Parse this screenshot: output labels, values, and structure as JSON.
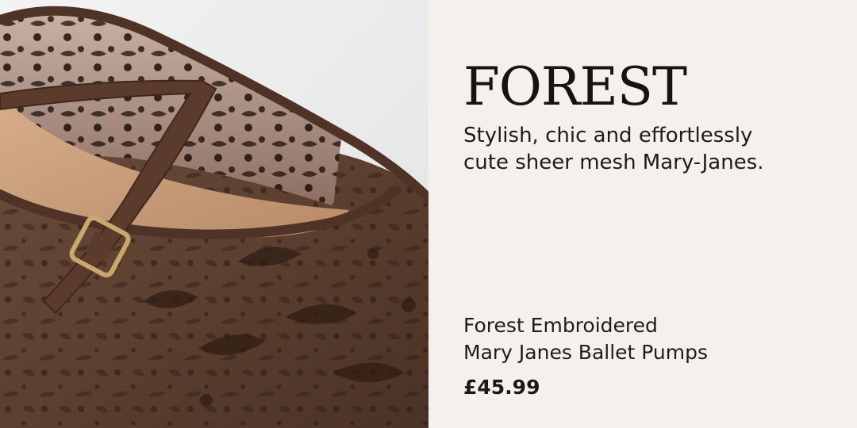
{
  "banner": {
    "title": "FOREST",
    "tagline_line1": "Stylish, chic and effortlessly",
    "tagline_line2": "cute sheer mesh Mary-Janes.",
    "product_name_line1": "Forest Embroidered",
    "product_name_line2": "Mary Janes Ballet Pumps",
    "price": "£45.99"
  },
  "colors": {
    "text_panel_bg": "#f4f1ec",
    "text_color": "#1d1b1b",
    "shoe_brown": "#5a3f30",
    "insole_tan": "#c79c7a",
    "buckle_gold": "#c9a86a"
  },
  "image": {
    "subject": "brown-embroidered-mesh-mary-jane-shoe"
  }
}
